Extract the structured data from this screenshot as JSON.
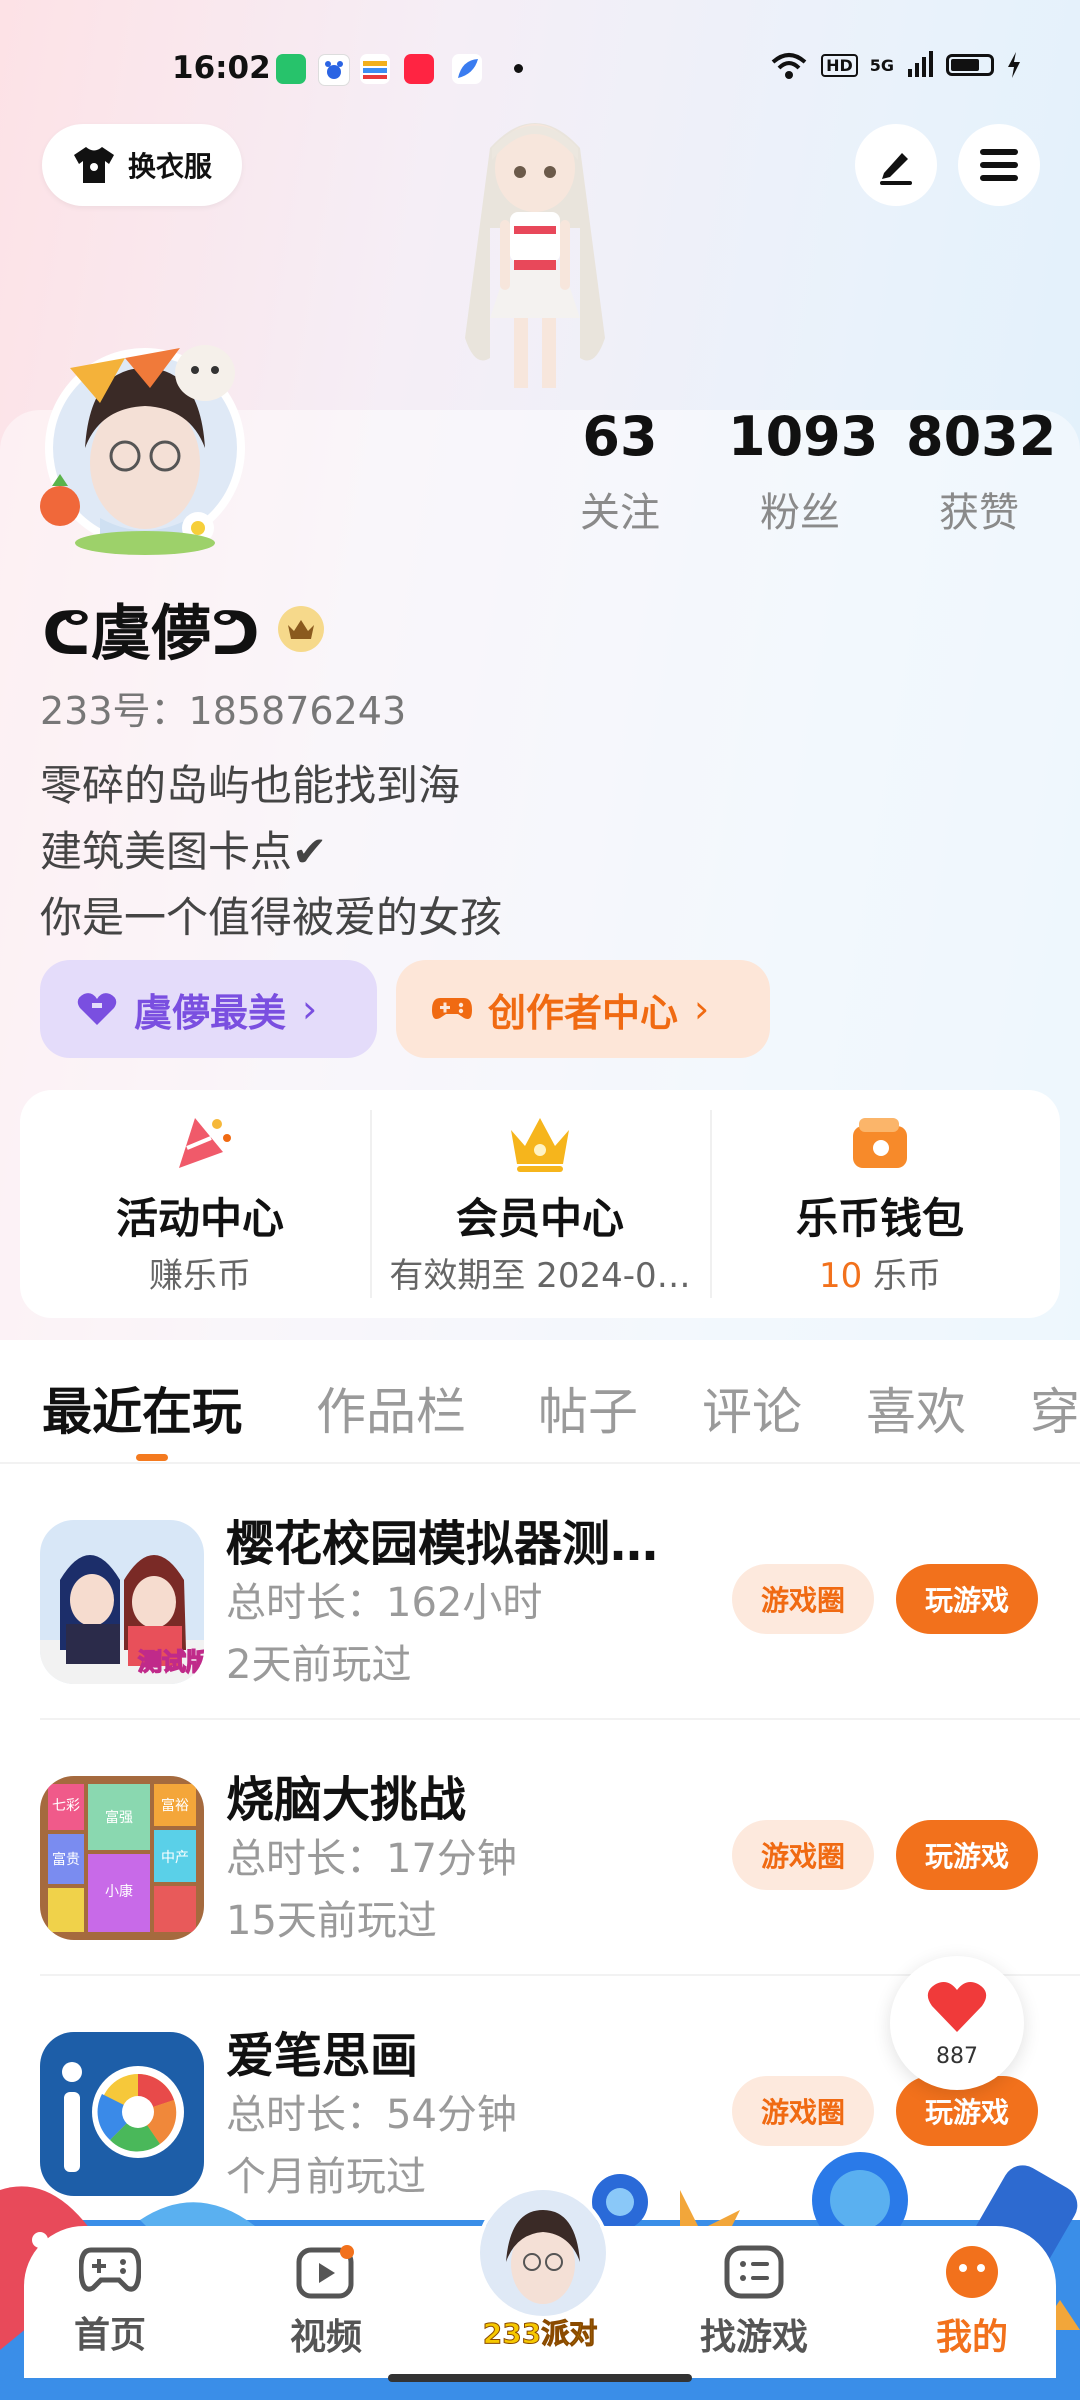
{
  "status_bar": {
    "time": "16:02",
    "network_label": "5G",
    "hd_label": "HD"
  },
  "header": {
    "outfit_label": "换衣服"
  },
  "profile": {
    "stats": [
      {
        "value": "63",
        "label": "关注"
      },
      {
        "value": "1093",
        "label": "粉丝"
      },
      {
        "value": "8032",
        "label": "获赞"
      }
    ],
    "nickname": "ᕦ虞儚ᕤ",
    "uid": "233号：185876243",
    "bio": [
      "零碎的岛屿也能找到海",
      "建筑美图卡点✔",
      "你是一个值得被爱的女孩"
    ],
    "fan_group_label": "虞儚最美",
    "creator_center_label": "创作者中心"
  },
  "services": [
    {
      "title": "活动中心",
      "subtitle": "赚乐币",
      "icon": "party-popper-icon"
    },
    {
      "title": "会员中心",
      "subtitle": "有效期至 2024-0…",
      "icon": "crown-icon"
    },
    {
      "title": "乐币钱包",
      "amount": "10",
      "unit": "乐币",
      "icon": "wallet-icon"
    }
  ],
  "tabs": [
    "最近在玩",
    "作品栏",
    "帖子",
    "评论",
    "喜欢",
    "穿"
  ],
  "games": [
    {
      "title": "樱花校园模拟器测…",
      "duration": "总时长：162小时",
      "last_played": "2天前玩过",
      "circle_label": "游戏圈",
      "play_label": "玩游戏"
    },
    {
      "title": "烧脑大挑战",
      "duration": "总时长：17分钟",
      "last_played": "15天前玩过",
      "circle_label": "游戏圈",
      "play_label": "玩游戏"
    },
    {
      "title": "爱笔思画",
      "duration": "总时长：54分钟",
      "last_played": "个月前玩过",
      "circle_label": "游戏圈",
      "play_label": "玩游戏"
    }
  ],
  "game_icon_texts": {
    "sakura_badge": "测试版",
    "brain_cells": [
      "七彩",
      "富强",
      "富裕",
      "富贵",
      "小康",
      "中产"
    ]
  },
  "like_float": {
    "count": "887"
  },
  "bottom_nav": [
    {
      "label": "首页",
      "icon": "gamepad-icon"
    },
    {
      "label": "视频",
      "icon": "video-icon"
    },
    {
      "label": "233派对",
      "icon": "party-avatar-icon"
    },
    {
      "label": "找游戏",
      "icon": "list-icon"
    },
    {
      "label": "我的",
      "icon": "face-icon"
    }
  ],
  "colors": {
    "accent": "#f2711c",
    "fan_purple": "#7a4fe0",
    "muted_text": "#9a9a9a"
  }
}
